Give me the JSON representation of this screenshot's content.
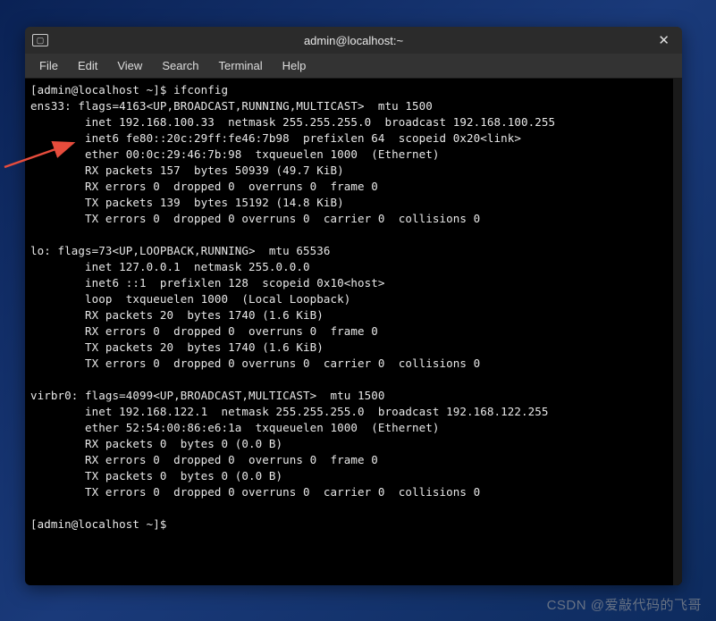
{
  "window": {
    "title": "admin@localhost:~"
  },
  "menubar": {
    "file": "File",
    "edit": "Edit",
    "view": "View",
    "search": "Search",
    "terminal": "Terminal",
    "help": "Help"
  },
  "terminal": {
    "prompt1": "[admin@localhost ~]$ ",
    "command1": "ifconfig",
    "output": "ens33: flags=4163<UP,BROADCAST,RUNNING,MULTICAST>  mtu 1500\n        inet 192.168.100.33  netmask 255.255.255.0  broadcast 192.168.100.255\n        inet6 fe80::20c:29ff:fe46:7b98  prefixlen 64  scopeid 0x20<link>\n        ether 00:0c:29:46:7b:98  txqueuelen 1000  (Ethernet)\n        RX packets 157  bytes 50939 (49.7 KiB)\n        RX errors 0  dropped 0  overruns 0  frame 0\n        TX packets 139  bytes 15192 (14.8 KiB)\n        TX errors 0  dropped 0 overruns 0  carrier 0  collisions 0\n\nlo: flags=73<UP,LOOPBACK,RUNNING>  mtu 65536\n        inet 127.0.0.1  netmask 255.0.0.0\n        inet6 ::1  prefixlen 128  scopeid 0x10<host>\n        loop  txqueuelen 1000  (Local Loopback)\n        RX packets 20  bytes 1740 (1.6 KiB)\n        RX errors 0  dropped 0  overruns 0  frame 0\n        TX packets 20  bytes 1740 (1.6 KiB)\n        TX errors 0  dropped 0 overruns 0  carrier 0  collisions 0\n\nvirbr0: flags=4099<UP,BROADCAST,MULTICAST>  mtu 1500\n        inet 192.168.122.1  netmask 255.255.255.0  broadcast 192.168.122.255\n        ether 52:54:00:86:e6:1a  txqueuelen 1000  (Ethernet)\n        RX packets 0  bytes 0 (0.0 B)\n        RX errors 0  dropped 0  overruns 0  frame 0\n        TX packets 0  bytes 0 (0.0 B)\n        TX errors 0  dropped 0 overruns 0  carrier 0  collisions 0\n",
    "prompt2": "[admin@localhost ~]$ "
  },
  "watermark": "CSDN @爱敲代码的飞哥"
}
